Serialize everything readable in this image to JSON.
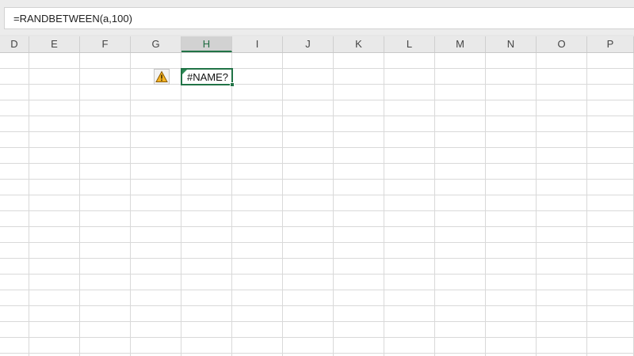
{
  "formula_bar": {
    "formula": "=RANDBETWEEN(a,100)"
  },
  "columns": [
    {
      "label": "D",
      "selected": false
    },
    {
      "label": "E",
      "selected": false
    },
    {
      "label": "F",
      "selected": false
    },
    {
      "label": "G",
      "selected": false
    },
    {
      "label": "H",
      "selected": true
    },
    {
      "label": "I",
      "selected": false
    },
    {
      "label": "J",
      "selected": false
    },
    {
      "label": "K",
      "selected": false
    },
    {
      "label": "L",
      "selected": false
    },
    {
      "label": "M",
      "selected": false
    },
    {
      "label": "N",
      "selected": false
    },
    {
      "label": "O",
      "selected": false
    },
    {
      "label": "P",
      "selected": false
    }
  ],
  "active_cell": {
    "value": "#NAME?"
  },
  "error_indicator": {
    "icon": "warning-icon",
    "color": "#f0a30a"
  },
  "colors": {
    "accent": "#217346",
    "grid": "#d9d9d9"
  }
}
